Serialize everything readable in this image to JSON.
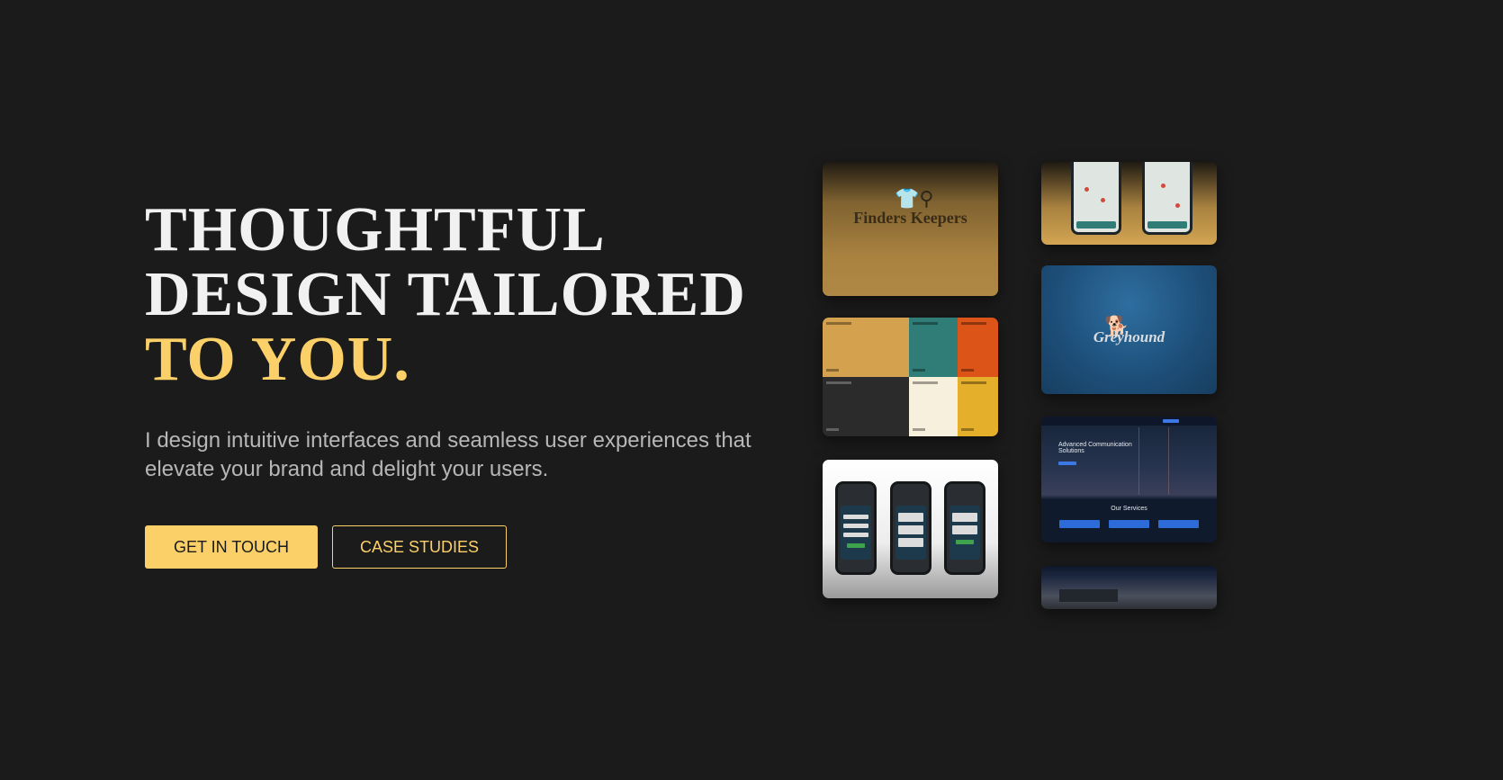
{
  "hero": {
    "headline_line1": "THOUGHTFUL",
    "headline_line2": "DESIGN TAILORED",
    "headline_line3": "TO YOU.",
    "subtitle": "I design intuitive interfaces and seamless user experiences that elevate your brand and delight your users."
  },
  "buttons": {
    "primary_label": "GET IN TOUCH",
    "secondary_label": "CASE STUDIES"
  },
  "gallery": {
    "finders_keepers_brand": "Finders Keepers",
    "greyhound_brand": "Greyhound",
    "website_hero_title": "Advanced Communication Solutions",
    "website_services_title": "Our Services"
  },
  "palette_colors": [
    "#d4a24f",
    "#2f7d76",
    "#dc5418",
    "#2b2b2b",
    "#f7f0dc",
    "#e4b02b"
  ],
  "colors": {
    "background": "#1b1b1b",
    "accent": "#fcd068",
    "headline": "#f1f1f1",
    "body_text": "#b7b7b7"
  },
  "icons": {
    "finders_logo": "tshirt-bicycle-icon",
    "greyhound_logo": "running-dog-icon"
  }
}
